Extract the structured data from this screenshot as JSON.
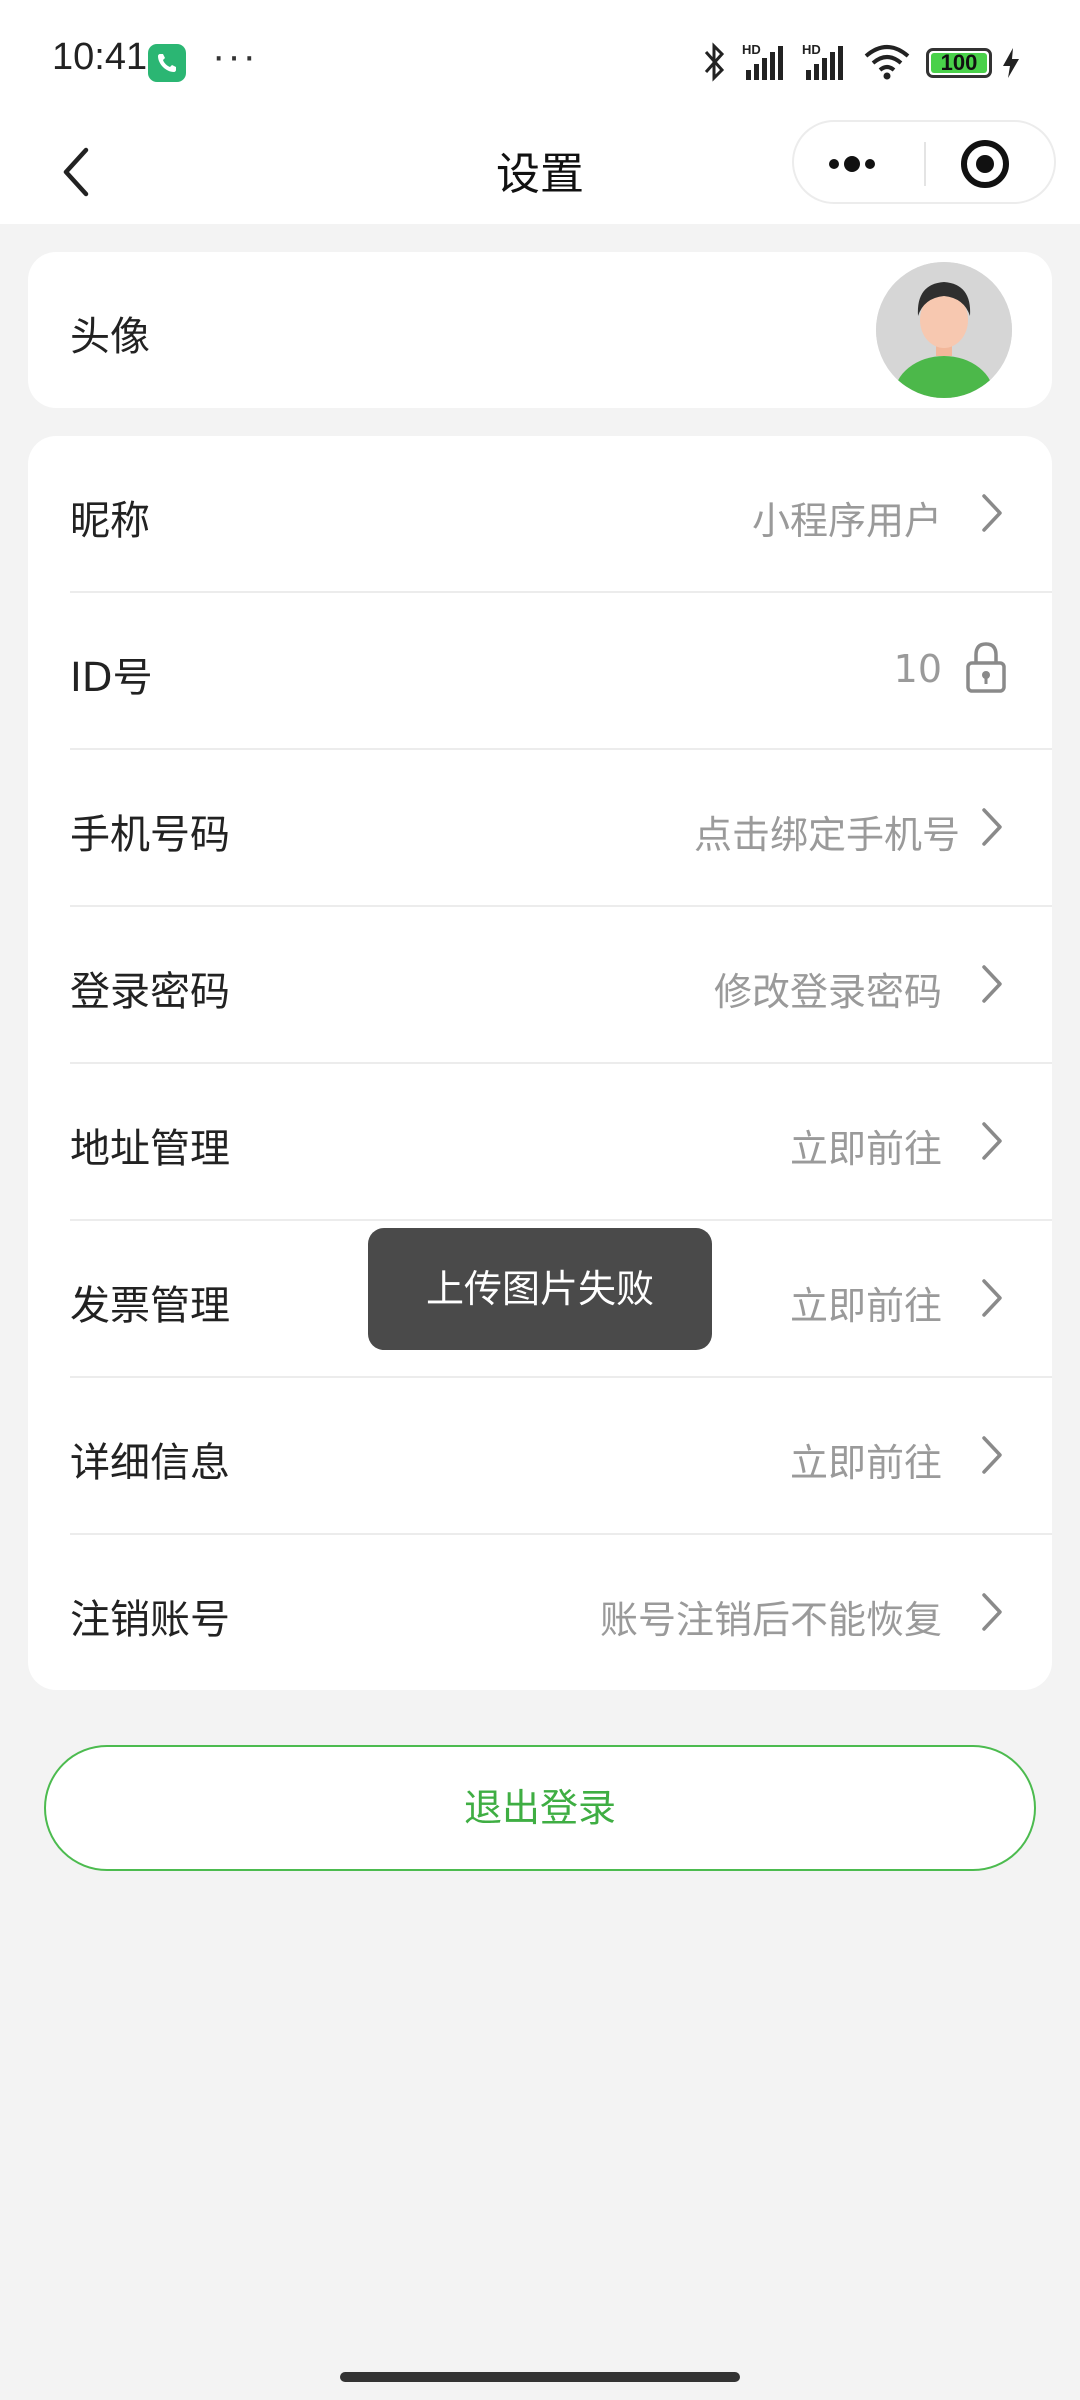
{
  "status_bar": {
    "time": "10:41",
    "more_dots": "···",
    "battery_level": "100",
    "icons": [
      "bluetooth-icon",
      "hd-signal-icon",
      "hd-signal-icon",
      "wifi-icon",
      "battery-icon",
      "charging-icon"
    ]
  },
  "nav": {
    "title": "设置",
    "back_icon": "back-chevron-icon",
    "more_icon": "more-dots-icon",
    "close_icon": "target-close-icon"
  },
  "avatar_row": {
    "label": "头像"
  },
  "settings": [
    {
      "label": "昵称",
      "value": "小程序用户",
      "trailing": "chevron"
    },
    {
      "label": "ID号",
      "value": "10",
      "trailing": "lock"
    },
    {
      "label": "手机号码",
      "value": "点击绑定手机号",
      "trailing": "chevron"
    },
    {
      "label": "登录密码",
      "value": "修改登录密码",
      "trailing": "chevron"
    },
    {
      "label": "地址管理",
      "value": "立即前往",
      "trailing": "chevron"
    },
    {
      "label": "发票管理",
      "value": "立即前往",
      "trailing": "chevron"
    },
    {
      "label": "详细信息",
      "value": "立即前往",
      "trailing": "chevron"
    },
    {
      "label": "注销账号",
      "value": "账号注销后不能恢复",
      "trailing": "chevron"
    }
  ],
  "toast": {
    "message": "上传图片失败"
  },
  "logout": {
    "label": "退出登录"
  },
  "colors": {
    "accent": "#3fae43",
    "toast_bg": "#4a4a4a",
    "page_bg": "#f3f3f3"
  }
}
